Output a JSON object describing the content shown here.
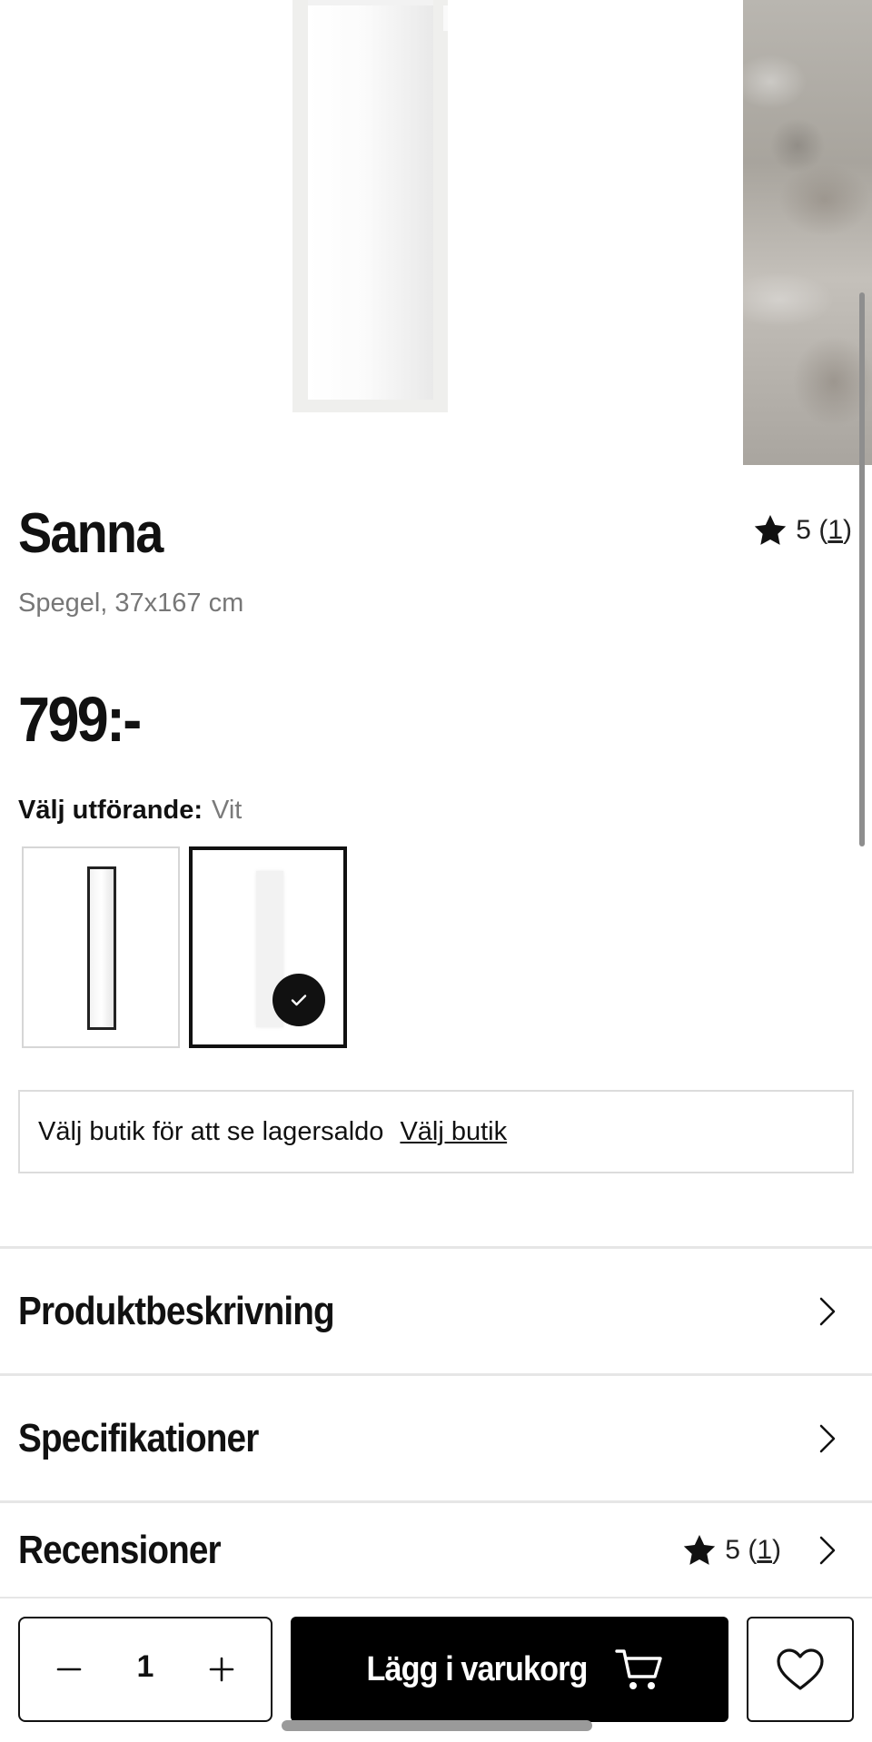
{
  "product": {
    "name": "Sanna",
    "subtitle": "Spegel, 37x167 cm",
    "price": "799:-",
    "rating": {
      "score": "5",
      "count": "1",
      "open_paren": "(",
      "close_paren": ")"
    }
  },
  "variant": {
    "label": "Välj utförande:",
    "selected": "Vit",
    "options": [
      {
        "icon": "black-frame-mirror-thumbnail",
        "selected": false
      },
      {
        "icon": "white-frame-mirror-thumbnail",
        "selected": true
      }
    ]
  },
  "store": {
    "text": "Välj butik för att se lagersaldo",
    "link": "Välj butik"
  },
  "accordion": [
    {
      "title": "Produktbeskrivning"
    },
    {
      "title": "Specifikationer"
    },
    {
      "title": "Recensioner",
      "rating": "5",
      "count": "1"
    }
  ],
  "cart": {
    "quantity": "1",
    "add_label": "Lägg i varukorg"
  },
  "colors": {
    "primary": "#000000",
    "text": "#111111",
    "muted": "#777777",
    "border": "#dcdcdc"
  }
}
